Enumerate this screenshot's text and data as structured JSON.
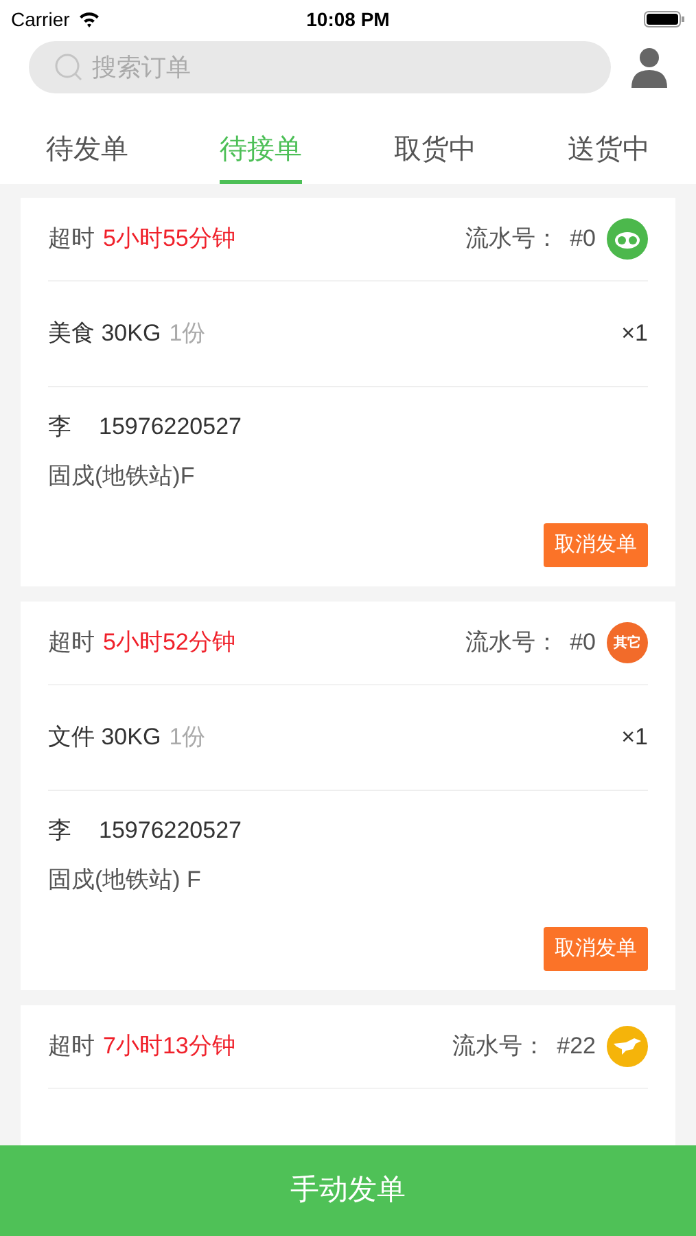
{
  "status_bar": {
    "carrier": "Carrier",
    "time": "10:08 PM"
  },
  "search": {
    "placeholder": "搜索订单"
  },
  "tabs": [
    {
      "label": "待发单",
      "selected": false
    },
    {
      "label": "待接单",
      "selected": true
    },
    {
      "label": "取货中",
      "selected": false
    },
    {
      "label": "送货中",
      "selected": false
    }
  ],
  "orders": [
    {
      "overdue_label": "超时",
      "overdue_time": "5小时55分钟",
      "serial_label": "流水号：",
      "serial": "#0",
      "badge": {
        "kind": "icon",
        "color": "#4cb84c"
      },
      "item": "美食 30KG",
      "copies": "1份",
      "quantity": "×1",
      "contact_name": "李",
      "phone": "15976220527",
      "address": "固戍(地铁站)F",
      "cancel_button": "取消发单"
    },
    {
      "overdue_label": "超时",
      "overdue_time": "5小时52分钟",
      "serial_label": "流水号：",
      "serial": "#0",
      "badge": {
        "kind": "text",
        "color": "#f26b2a",
        "text": "其它"
      },
      "item": "文件 30KG",
      "copies": "1份",
      "quantity": "×1",
      "contact_name": "李",
      "phone": "15976220527",
      "address": "固戍(地铁站) F",
      "cancel_button": "取消发单"
    },
    {
      "overdue_label": "超时",
      "overdue_time": "7小时13分钟",
      "serial_label": "流水号：",
      "serial": "#22",
      "badge": {
        "kind": "bird",
        "color": "#f5b40a"
      }
    }
  ],
  "bottom_button": "手动发单"
}
